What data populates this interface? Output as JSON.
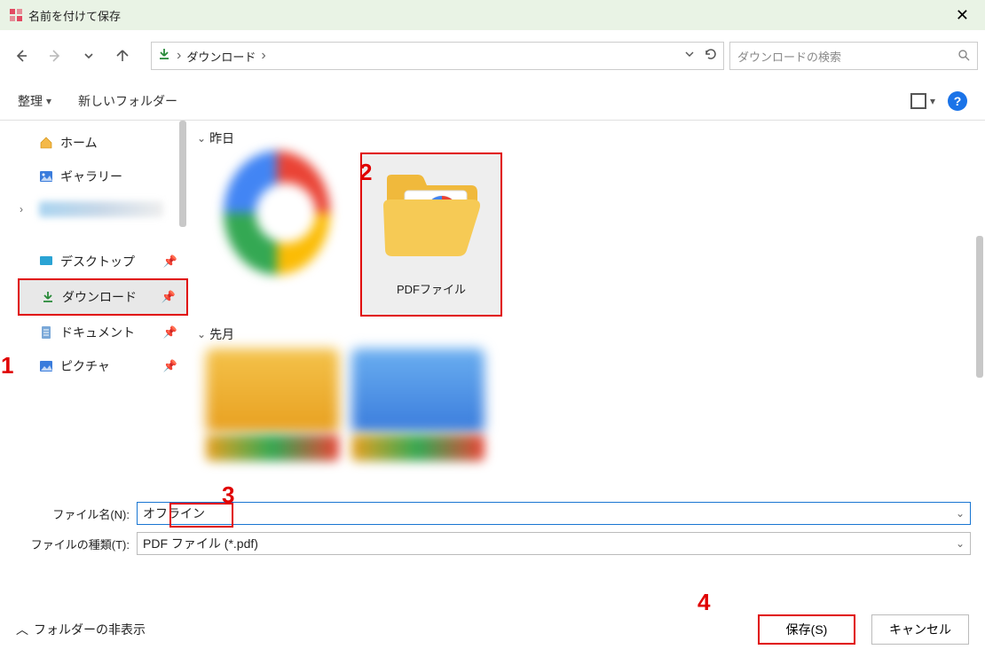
{
  "window": {
    "title": "名前を付けて保存"
  },
  "address": {
    "location": "ダウンロード",
    "sep": "›",
    "search_placeholder": "ダウンロードの検索"
  },
  "toolbar": {
    "organize": "整理",
    "new_folder": "新しいフォルダー"
  },
  "sidebar": {
    "home": "ホーム",
    "gallery": "ギャラリー",
    "desktop": "デスクトップ",
    "downloads": "ダウンロード",
    "documents": "ドキュメント",
    "pictures": "ピクチャ"
  },
  "content": {
    "section_yesterday": "昨日",
    "section_lastmonth": "先月",
    "folder_label": "PDFファイル"
  },
  "form": {
    "filename_label": "ファイル名(N):",
    "filename_value": "オフライン",
    "filetype_label": "ファイルの種類(T):",
    "filetype_value": "PDF ファイル (*.pdf)"
  },
  "footer": {
    "hide_folders": "フォルダーの非表示",
    "save": "保存(S)",
    "cancel": "キャンセル"
  },
  "markers": {
    "m1": "1",
    "m2": "2",
    "m3": "3",
    "m4": "4"
  }
}
